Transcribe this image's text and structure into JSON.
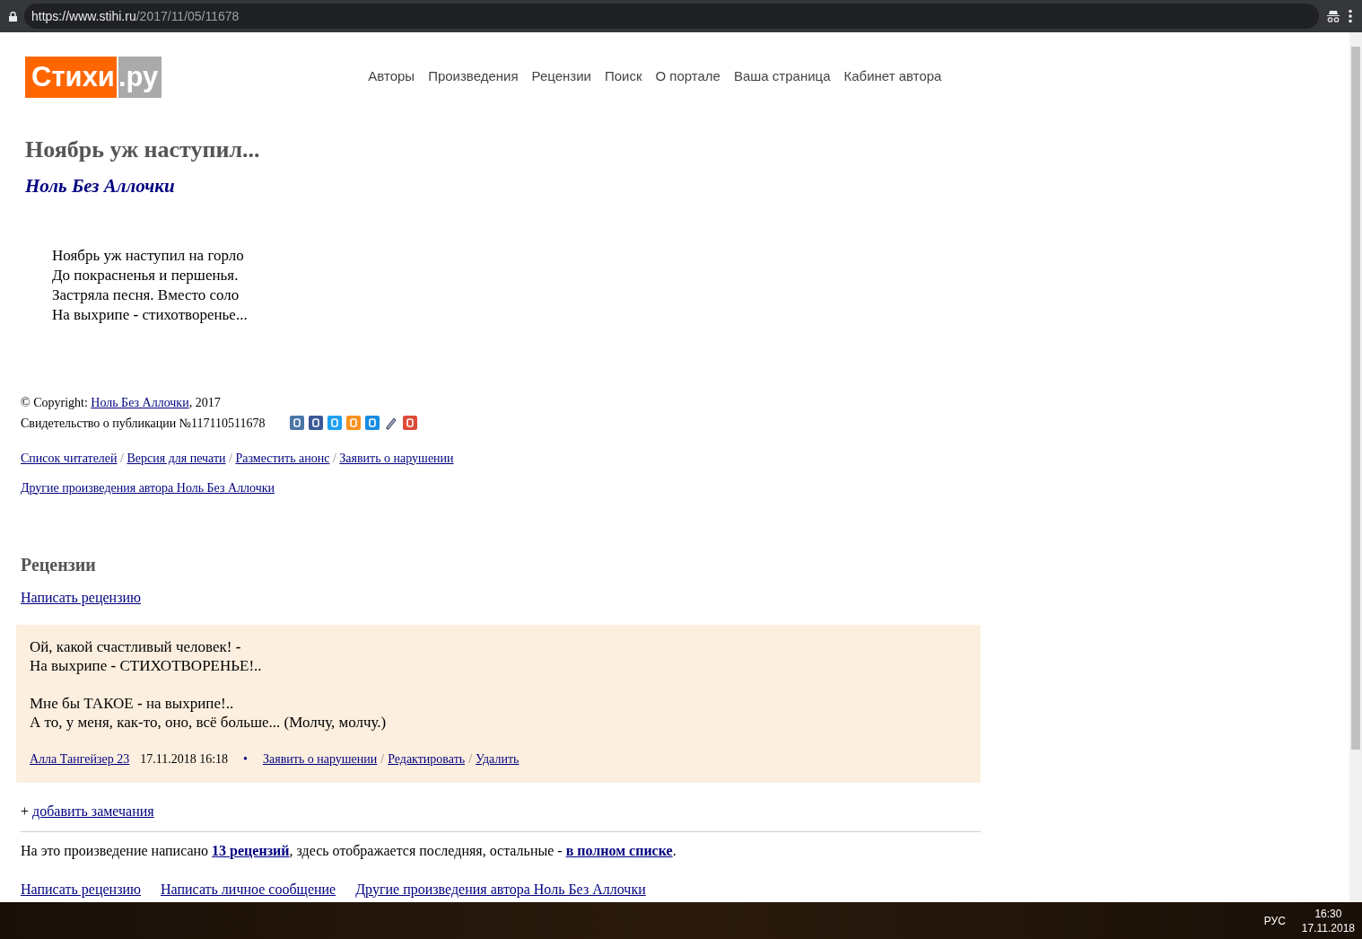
{
  "browser": {
    "url_host": "https://www.stihi.ru",
    "url_path": "/2017/11/05/11678"
  },
  "site": {
    "logo": {
      "main": "Стихи",
      "suffix": ".ру"
    },
    "nav": [
      "Авторы",
      "Произведения",
      "Рецензии",
      "Поиск",
      "О портале",
      "Ваша страница",
      "Кабинет автора"
    ]
  },
  "poem": {
    "title": "Ноябрь уж наступил...",
    "author": "Ноль Без Аллочки",
    "lines": [
      "Ноябрь уж наступил на горло",
      "До покрасненья и першенья.",
      "Застряла песня. Вместо соло",
      "На выхрипе **-** стихотворенье..."
    ]
  },
  "copyright": {
    "prefix": "© Copyright: ",
    "author": "Ноль Без Аллочки",
    "suffix": ", 2017",
    "certificate": "Свидетельство о публикации №117110511678"
  },
  "separator": "/",
  "work_links": [
    "Список читателей",
    "Версия для печати",
    "Разместить анонс",
    "Заявить о нарушении"
  ],
  "other_works_link": "Другие произведения автора Ноль Без Аллочки",
  "reviews": {
    "heading": "Рецензии",
    "write_link": "Написать рецензию",
    "items": [
      {
        "paragraphs": [
          [
            "Ой, какой счастливый человек! **-**",
            "На выхрипе **-** СТИХОТВОРЕНЬЕ!.."
          ],
          [
            "Мне бы ТАКОЕ **-** на выхрипе!..",
            "А то, у меня, как-то, оно, всё больше... (Молчу, молчу.)"
          ]
        ],
        "author": "Алла Тангейзер 23",
        "date": "17.11.2018 16:18",
        "bullet": "•",
        "actions": [
          "Заявить о нарушении",
          "Редактировать",
          "Удалить"
        ]
      }
    ],
    "add_remarks": {
      "plus": "+",
      "link": "добавить замечания"
    },
    "summary": {
      "before": "На это произведение написано ",
      "count_link": "13 рецензий",
      "middle": ", здесь отображается последняя, остальные - ",
      "list_link": "в полном списке",
      "after": "."
    },
    "bottom_links": [
      "Написать рецензию",
      "Написать личное сообщение",
      "Другие произведения автора Ноль Без Аллочки"
    ]
  },
  "taskbar": {
    "language": "РУС",
    "time": "16:30",
    "date": "17.11.2018"
  }
}
